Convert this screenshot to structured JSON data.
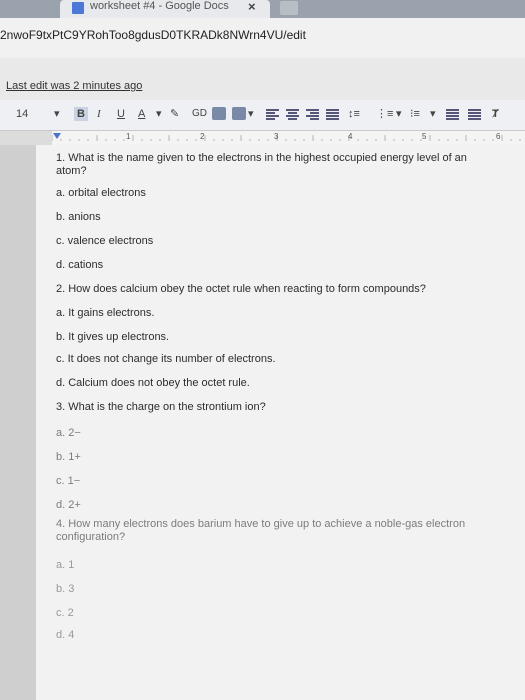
{
  "browser": {
    "tab_title": "worksheet #4 - Google Docs",
    "tab_close": "×",
    "url": "2nwoF9txPtC9YRohToo8gdusD0TKRADk8NWrn4VU/edit"
  },
  "docs": {
    "last_edit": "Last edit was 2 minutes ago",
    "toolbar": {
      "font_size": "14",
      "bold": "B",
      "italic": "I",
      "underline": "U",
      "text_color": "A",
      "link": "GD"
    },
    "ruler_numbers": [
      "1",
      "2",
      "3",
      "4",
      "5",
      "6"
    ]
  },
  "worksheet": {
    "q1_line1": "1. What is the name given to the electrons in the highest occupied energy level of an",
    "q1_line2": "atom?",
    "q1_a": "a. orbital electrons",
    "q1_b": "b. anions",
    "q1_c": "c. valence electrons",
    "q1_d": "d. cations",
    "q2": "2. How does calcium obey the octet rule when reacting to form compounds?",
    "q2_a": "a. It gains electrons.",
    "q2_b": "b. It gives up electrons.",
    "q2_c": "c. It does not change its number of electrons.",
    "q2_d": "d. Calcium does not obey the octet rule.",
    "q3": "3. What is the charge on the strontium ion?",
    "q3_a": "a. 2−",
    "q3_b": "b. 1+",
    "q3_c": "c. 1−",
    "q3_d": "d. 2+",
    "q4_line1": "4. How many electrons does barium have to give up to achieve a noble-gas electron",
    "q4_line2": "configuration?",
    "q4_a": "a. 1",
    "q4_b": "b. 3",
    "q4_c": "c. 2",
    "q4_d": "d. 4"
  }
}
